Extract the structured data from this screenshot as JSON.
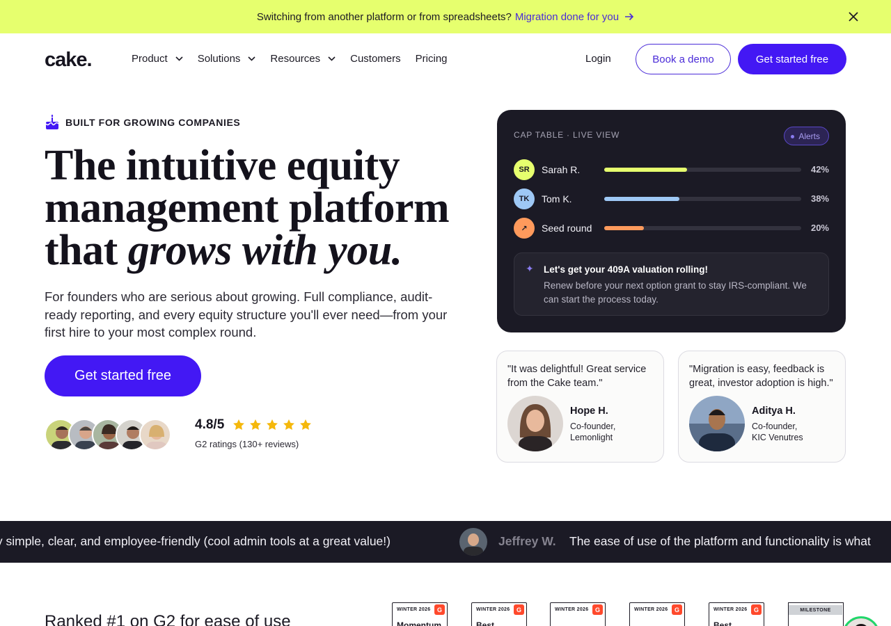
{
  "announcement": {
    "text": "Switching from another platform or from spreadsheets?",
    "link": "Migration done for you"
  },
  "nav": {
    "logo": "cake.",
    "items": [
      {
        "label": "Product",
        "dropdown": true
      },
      {
        "label": "Solutions",
        "dropdown": true
      },
      {
        "label": "Resources",
        "dropdown": true
      },
      {
        "label": "Customers",
        "dropdown": false
      },
      {
        "label": "Pricing",
        "dropdown": false
      }
    ],
    "login": "Login",
    "book_demo": "Book a demo",
    "get_started": "Get started free"
  },
  "hero": {
    "eyebrow": "BUILT FOR GROWING COMPANIES",
    "headline_line1": "The intuitive equity",
    "headline_line2": "management platform",
    "headline_line3_plain": "that ",
    "headline_line3_italic": "grows with you.",
    "subcopy": "For founders who are serious about growing. Full compliance, audit-ready reporting, and every equity structure you'll ever need—from your first hire to your most complex round.",
    "cta": "Get started free",
    "rating_score": "4.8/5",
    "rating_stars": 5,
    "rating_sub": "G2 ratings (130+ reviews)"
  },
  "cap_table": {
    "label": "CAP TABLE · LIVE VIEW",
    "alerts": "Alerts",
    "rows": [
      {
        "initials": "SR",
        "name": "Sarah R.",
        "percent": "42%",
        "value": 42,
        "color": "#e6ff6e"
      },
      {
        "initials": "TK",
        "name": "Tom K.",
        "percent": "38%",
        "value": 38,
        "color": "#9ec8f5"
      },
      {
        "initials": "↗",
        "name": "Seed round",
        "percent": "20%",
        "value": 20,
        "color": "#ff9a5c"
      }
    ],
    "notice_title": "Let's get your 409A valuation rolling!",
    "notice_text": "Renew before your next option grant to stay IRS-compliant. We can start the process today."
  },
  "testimonials": [
    {
      "quote": "\"It was delightful! Great service from the Cake team.\"",
      "name": "Hope H.",
      "role_line1": "Co-founder,",
      "role_line2": "Lemonlight"
    },
    {
      "quote": "\"Migration is easy, feedback is great, investor adoption is high.\"",
      "name": "Aditya H.",
      "role_line1": "Co-founder,",
      "role_line2": "KIC Venutres"
    }
  ],
  "ticker": {
    "text1": "ty simple, clear, and employee-friendly (cool admin tools at a great value!)",
    "name": "Jeffrey W.",
    "text2": "The ease of use of the platform and functionality is what"
  },
  "bottom": {
    "ranked": "Ranked #1 on G2 for ease of use",
    "badges": [
      {
        "season": "WINTER 2026",
        "word": "Momentum"
      },
      {
        "season": "WINTER 2026",
        "word": "Best"
      },
      {
        "season": "WINTER 2026",
        "word": ""
      },
      {
        "season": "WINTER 2026",
        "word": ""
      },
      {
        "season": "WINTER 2026",
        "word": "Best"
      }
    ],
    "milestone": "MILESTONE"
  },
  "colors": {
    "announce_bg": "#e6ff6e",
    "brand": "#4318f4",
    "dark": "#1b1a25"
  }
}
